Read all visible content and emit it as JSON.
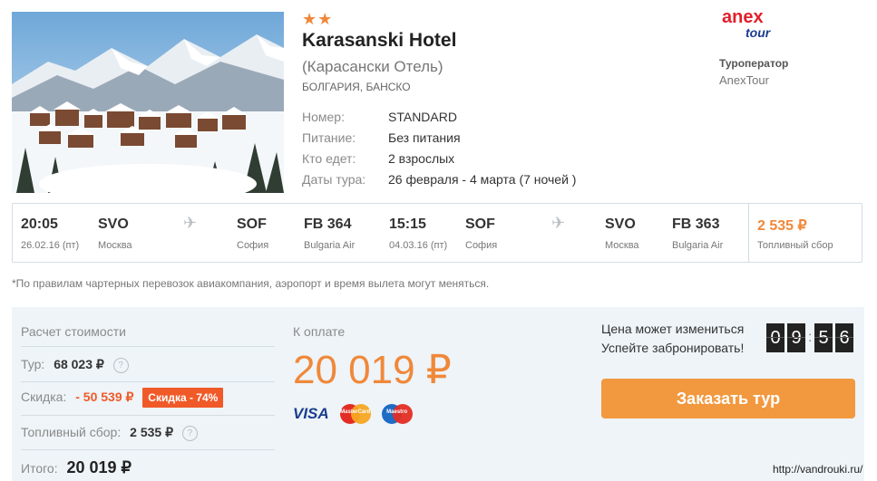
{
  "hotel": {
    "stars": "★★",
    "name": "Karasanski Hotel",
    "alt_name": "(Карасански Отель)",
    "location": "БОЛГАРИЯ, БАНСКО",
    "details": [
      {
        "label": "Номер:",
        "value": "STANDARD"
      },
      {
        "label": "Питание:",
        "value": "Без питания"
      },
      {
        "label": "Кто едет:",
        "value": "2 взрослых"
      },
      {
        "label": "Даты тура:",
        "value": "26 февраля - 4 марта (7 ночей )"
      }
    ]
  },
  "operator": {
    "logo_top": "anex",
    "logo_bottom": "tour",
    "label": "Туроператор",
    "name": "AnexTour"
  },
  "flights": {
    "outbound": {
      "time": "20:05",
      "date": "26.02.16 (пт)",
      "from_code": "SVO",
      "from_city": "Москва",
      "to_code": "SOF",
      "to_city": "София",
      "flight_no": "FB 364",
      "airline": "Bulgaria Air"
    },
    "return": {
      "time": "15:15",
      "date": "04.03.16 (пт)",
      "from_code": "SOF",
      "from_city": "София",
      "to_code": "SVO",
      "to_city": "Москва",
      "flight_no": "FB 363",
      "airline": "Bulgaria Air"
    },
    "fuel_price": "2 535 ₽",
    "fuel_label": "Топливный сбор"
  },
  "note": "*По правилам чартерных перевозок авиакомпания, аэропорт и время вылета могут меняться.",
  "calc": {
    "title": "Расчет стоимости",
    "tour_label": "Тур:",
    "tour_value": "68 023 ₽",
    "discount_label": "Скидка:",
    "discount_value": "- 50 539 ₽",
    "discount_badge": "Скидка - 74%",
    "fuel_label": "Топливный сбор:",
    "fuel_value": "2 535 ₽",
    "total_label": "Итого:",
    "total_value": "20 019 ₽",
    "help": "?"
  },
  "payment": {
    "label": "К оплате",
    "amount": "20 019 ₽",
    "cards": [
      "VISA",
      "MasterCard",
      "Maestro"
    ]
  },
  "booking": {
    "price_change": "Цена может измениться",
    "hurry": "Успейте забронировать!",
    "timer": [
      "0",
      "9",
      "5",
      "6"
    ],
    "order_button": "Заказать тур"
  },
  "watermark": "http://vandrouki.ru/",
  "colors": {
    "accent": "#f0883a",
    "discount": "#f05a28",
    "button": "#f2993f",
    "panel": "#eef4f8"
  }
}
